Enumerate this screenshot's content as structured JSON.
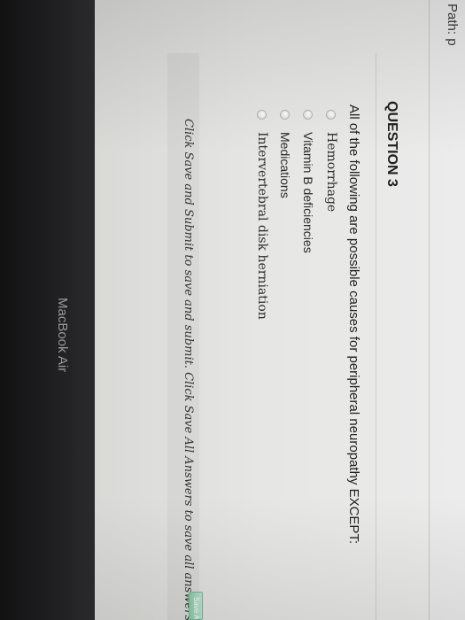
{
  "browser": {
    "path_label": "Path: p"
  },
  "question": {
    "title": "QUESTION 3",
    "prompt": "All of the following are possible causes for peripheral neuropathy EXCEPT:",
    "options": [
      {
        "label": "Hemorrhage"
      },
      {
        "label": "Vitamin B deficiencies"
      },
      {
        "label": "Medications"
      },
      {
        "label": "Intervertebral disk herniation"
      }
    ]
  },
  "footer": {
    "instructions": "Click Save and Submit to save and submit. Click Save All Answers to save all answers.",
    "save_all_label": "Save All"
  },
  "device": {
    "brand_label": "MacBook Air"
  }
}
